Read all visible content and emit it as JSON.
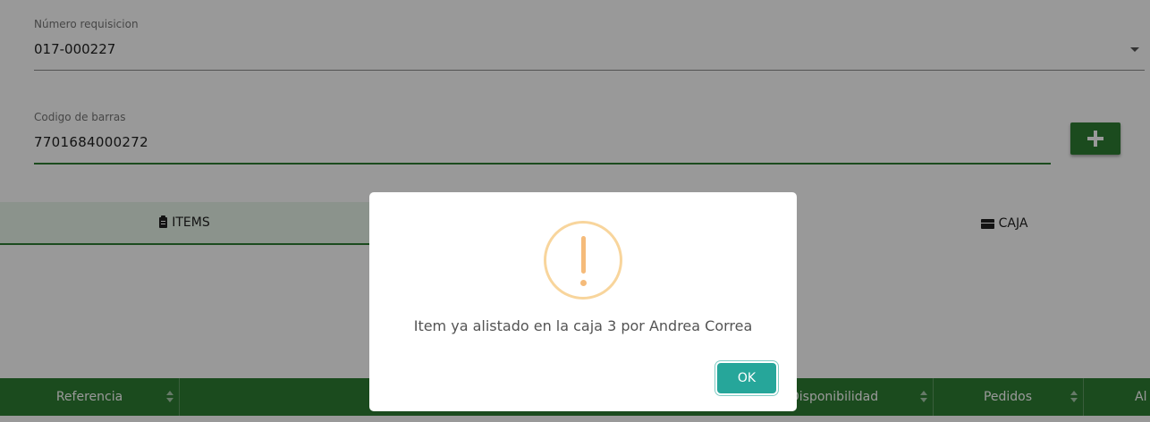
{
  "form": {
    "requisicion": {
      "label": "Número requisicion",
      "value": "017-000227"
    },
    "barcode": {
      "label": "Codigo de barras",
      "value": "7701684000272"
    }
  },
  "tabs": [
    {
      "label": "Items",
      "icon": "clipboard-icon",
      "active": true
    },
    {
      "label": "Caja",
      "icon": "box-icon",
      "active": false
    }
  ],
  "table": {
    "headers": [
      "Referencia",
      "",
      "Disponibilidad",
      "Pedidos",
      "Al"
    ]
  },
  "modal": {
    "icon": "warning-icon",
    "message": "Item ya alistado en la caja 3 por Andrea Correa",
    "ok_label": "OK"
  },
  "colors": {
    "primary": "#2e7d32",
    "ok_button": "#26a69a",
    "warning": "#f5bb7a"
  }
}
